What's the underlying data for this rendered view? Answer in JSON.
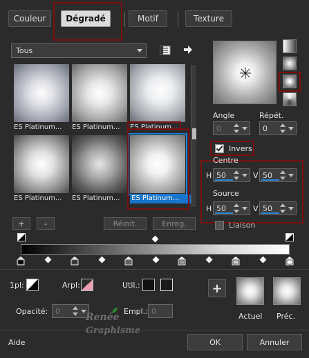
{
  "tabs": [
    {
      "label": "Couleur"
    },
    {
      "label": "Dégradé"
    },
    {
      "label": "Motif"
    },
    {
      "label": "Texture"
    }
  ],
  "category": {
    "selected": "Tous"
  },
  "presets": [
    {
      "label": "ES Platinum..."
    },
    {
      "label": "ES Platinum..."
    },
    {
      "label": "ES Platinum..."
    },
    {
      "label": "ES Platinum..."
    },
    {
      "label": "ES Platinum..."
    },
    {
      "label": "ES Platinum..."
    }
  ],
  "preset_buttons": {
    "add": "+",
    "remove": "-",
    "reset": "Réinit.",
    "save": "Enreg."
  },
  "angle": {
    "label": "Angle",
    "value": "0"
  },
  "repeat": {
    "label": "Répét.",
    "value": "0"
  },
  "invert": {
    "label": "Invers",
    "checked": true
  },
  "center": {
    "label": "Centre",
    "h_label": "H",
    "h_value": "50",
    "v_label": "V",
    "v_value": "50"
  },
  "source": {
    "label": "Source",
    "h_label": "H",
    "h_value": "50",
    "v_label": "V",
    "v_value": "50"
  },
  "link": {
    "label": "Liaison"
  },
  "gradient_stops": {
    "color_stops": 6,
    "midpoints": 5
  },
  "bottom": {
    "pi_label": "1pl:",
    "arpl_label": "Arpl:",
    "util_label": "Util.:",
    "opacity_label": "Opacité:",
    "opacity_value": "0",
    "empl_label": "Empl.:",
    "empl_value": "0",
    "add_label": "+",
    "current_label": "Actuel",
    "previous_label": "Préc."
  },
  "watermark": {
    "line1": "Renée",
    "line2": "Graphisme"
  },
  "footer": {
    "help": "Aide",
    "ok": "OK",
    "cancel": "Annuler"
  }
}
